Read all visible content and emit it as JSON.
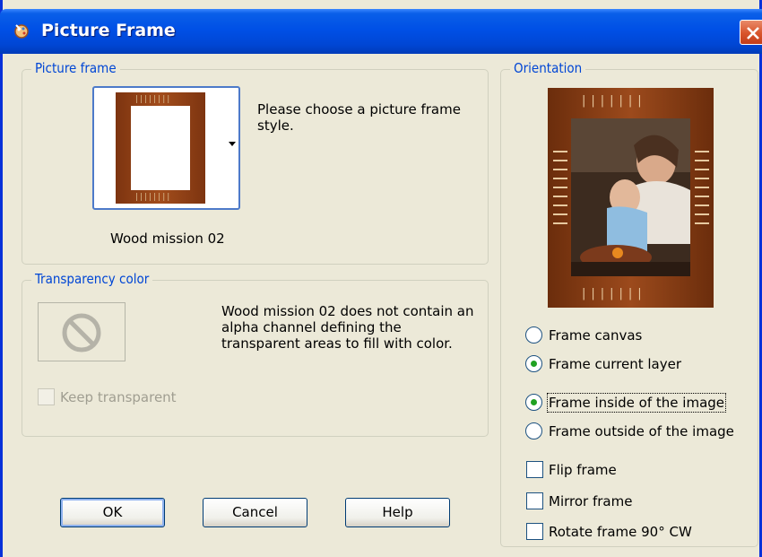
{
  "window": {
    "title": "Picture Frame"
  },
  "picture_frame": {
    "group_label": "Picture frame",
    "instruction": "Please choose a picture frame style.",
    "selected_frame": "Wood mission 02"
  },
  "transparency": {
    "group_label": "Transparency color",
    "message": "Wood mission 02 does not contain an alpha channel defining the transparent areas to fill with color.",
    "keep_transparent_label": "Keep transparent",
    "keep_transparent_checked": false,
    "keep_transparent_enabled": false
  },
  "orientation": {
    "group_label": "Orientation",
    "target_options": [
      {
        "label": "Frame canvas",
        "checked": false
      },
      {
        "label": "Frame current layer",
        "checked": true
      }
    ],
    "placement_options": [
      {
        "label": "Frame inside of the image",
        "checked": true
      },
      {
        "label": "Frame outside of the image",
        "checked": false
      }
    ],
    "checkboxes": [
      {
        "label": "Flip frame",
        "checked": false
      },
      {
        "label": "Mirror frame",
        "checked": false
      },
      {
        "label": "Rotate frame 90° CW",
        "checked": false
      }
    ]
  },
  "buttons": {
    "ok": "OK",
    "cancel": "Cancel",
    "help": "Help"
  },
  "colors": {
    "titlebar": "#0050e6",
    "dialog_bg": "#ece9d8",
    "group_label": "#0046d5",
    "close_button": "#d8542b",
    "radio_dot": "#21a121"
  }
}
